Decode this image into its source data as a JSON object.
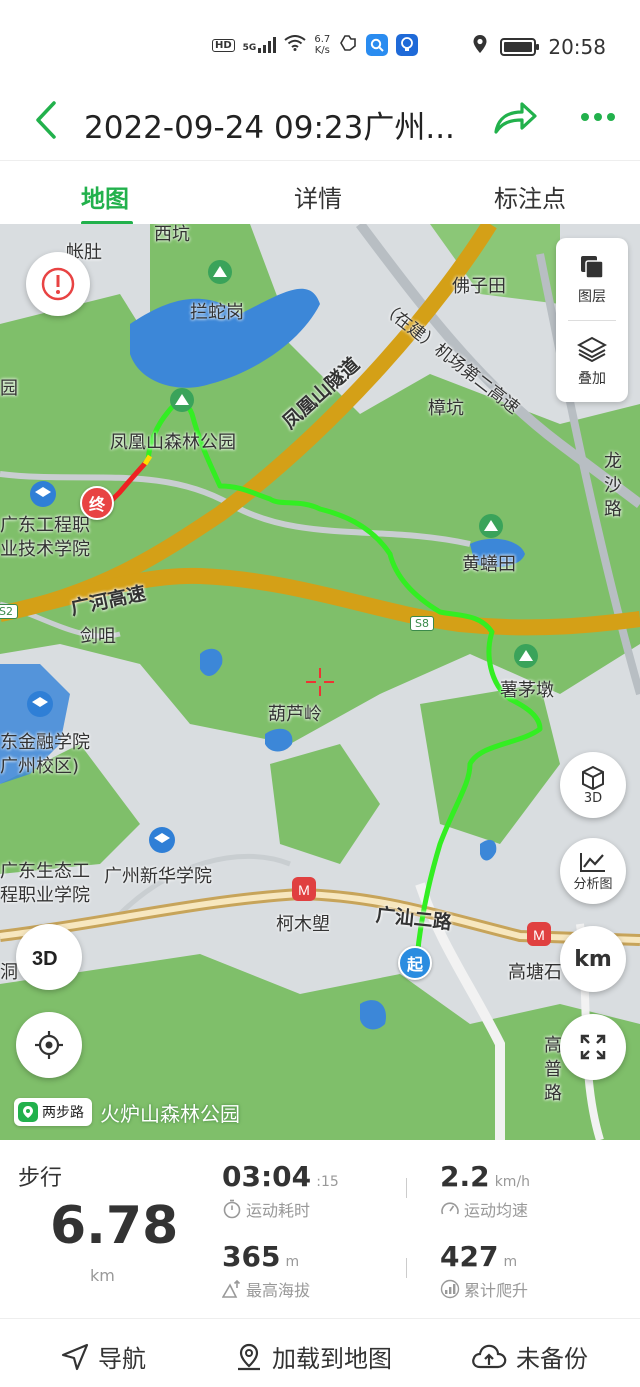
{
  "status_bar": {
    "network_badge": "HD",
    "signal_gen": "5G",
    "speed_value": "6.7",
    "speed_unit": "K/s",
    "time": "20:58",
    "battery_level": 1.0,
    "icons": [
      "hd-icon",
      "signal-icon",
      "wifi-icon",
      "hand-icon",
      "search-app-icon",
      "bulb-app-icon",
      "location-icon",
      "battery-icon"
    ]
  },
  "header": {
    "title": "2022-09-24 09:23广州...",
    "accent_color": "#22b14c"
  },
  "tabs": [
    {
      "label": "地图",
      "active": true
    },
    {
      "label": "详情",
      "active": false
    },
    {
      "label": "标注点",
      "active": false
    }
  ],
  "map": {
    "places": [
      {
        "text": "帐肚"
      },
      {
        "text": "西坑"
      },
      {
        "text": "拦蛇岗"
      },
      {
        "text": "佛子田"
      },
      {
        "text": "凤凰山森林公园"
      },
      {
        "text": "樟坑"
      },
      {
        "text": "广东工程职业技术学院"
      },
      {
        "text": "黄蟮田"
      },
      {
        "text": "剑咀"
      },
      {
        "text": "薯茅墩"
      },
      {
        "text": "葫芦岭"
      },
      {
        "text": "东金融学院"
      },
      {
        "text": "广州校区)"
      },
      {
        "text": "广东生态工程职业学院"
      },
      {
        "text": "广州新华学院"
      },
      {
        "text": "柯木塱"
      },
      {
        "text": "高塘石"
      },
      {
        "text": "火炉山森林公园"
      },
      {
        "text": "园"
      },
      {
        "text": "洞"
      },
      {
        "text": "龙沙路"
      },
      {
        "text": "高普路"
      }
    ],
    "roads": {
      "tunnel": "凤凰山隧道",
      "expressway": "广河高速",
      "airport_line": "（在建）机场第二高速",
      "avenue": "广汕二路",
      "s8_badge": "S8",
      "s2_badge": "S2"
    },
    "layer_panel": {
      "layers_label": "图层",
      "overlay_label": "叠加"
    },
    "buttons": {
      "three_d_label": "3D",
      "analysis_label": "分析图",
      "unit_label": "km"
    },
    "markers": {
      "start": "起",
      "end": "终"
    },
    "brand": "两步路",
    "route_color": "#33ee22"
  },
  "stats": {
    "mode": "步行",
    "distance": "6.78",
    "distance_unit": "km",
    "duration": "03:04",
    "duration_seconds": ":15",
    "duration_label": "运动耗时",
    "speed": "2.2",
    "speed_unit": "km/h",
    "speed_label": "运动均速",
    "max_altitude": "365",
    "max_altitude_unit": "m",
    "max_altitude_label": "最高海拔",
    "climb": "427",
    "climb_unit": "m",
    "climb_label": "累计爬升"
  },
  "bottom_bar": {
    "navigate": "导航",
    "load_to_map": "加载到地图",
    "backup": "未备份"
  }
}
